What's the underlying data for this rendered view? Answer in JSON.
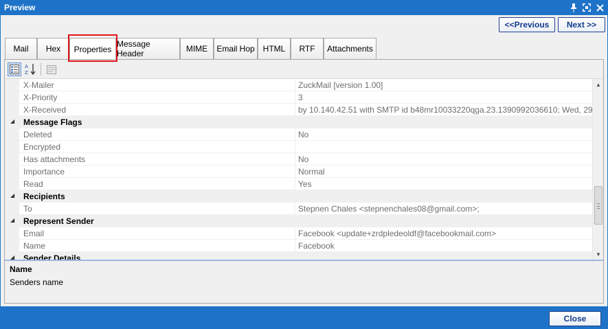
{
  "window": {
    "title": "Preview"
  },
  "nav": {
    "previous_label": "<<Previous",
    "next_label": "Next >>"
  },
  "tabs": [
    {
      "label": "Mail"
    },
    {
      "label": "Hex"
    },
    {
      "label": "Properties",
      "active": true
    },
    {
      "label": "Message Header"
    },
    {
      "label": "MIME"
    },
    {
      "label": "Email Hop"
    },
    {
      "label": "HTML"
    },
    {
      "label": "RTF"
    },
    {
      "label": "Attachments"
    }
  ],
  "toolbar": {
    "icons": [
      "categorized-icon",
      "alphabetical-sort-icon",
      "property-pages-icon"
    ]
  },
  "grid": {
    "rows": [
      {
        "type": "prop",
        "name": "X-Mailer",
        "value": "ZuckMail [version 1.00]"
      },
      {
        "type": "prop",
        "name": "X-Priority",
        "value": "3"
      },
      {
        "type": "prop",
        "name": "X-Received",
        "value": "by 10.140.42.51 with SMTP id b48mr10033220qga.23.1390992036610; Wed, 29 Jan 20"
      },
      {
        "type": "category",
        "name": "Message Flags"
      },
      {
        "type": "prop",
        "name": "Deleted",
        "value": "No"
      },
      {
        "type": "prop",
        "name": "Encrypted",
        "value": ""
      },
      {
        "type": "prop",
        "name": "Has attachments",
        "value": "No"
      },
      {
        "type": "prop",
        "name": "Importance",
        "value": "Normal"
      },
      {
        "type": "prop",
        "name": "Read",
        "value": "Yes"
      },
      {
        "type": "category",
        "name": "Recipients"
      },
      {
        "type": "prop",
        "name": "To",
        "value": "Stepnen Chales <stepnenchales08@gmail.com>;"
      },
      {
        "type": "category",
        "name": "Represent Sender"
      },
      {
        "type": "prop",
        "name": "Email",
        "value": "Facebook <update+zrdpledeoldf@facebookmail.com>"
      },
      {
        "type": "prop",
        "name": "Name",
        "value": "Facebook"
      },
      {
        "type": "category",
        "name": "Sender Details"
      }
    ]
  },
  "description": {
    "title": "Name",
    "text": "Senders name"
  },
  "footer": {
    "close_label": "Close"
  },
  "colors": {
    "accent": "#1e73c8",
    "highlight": "#e0151b"
  }
}
